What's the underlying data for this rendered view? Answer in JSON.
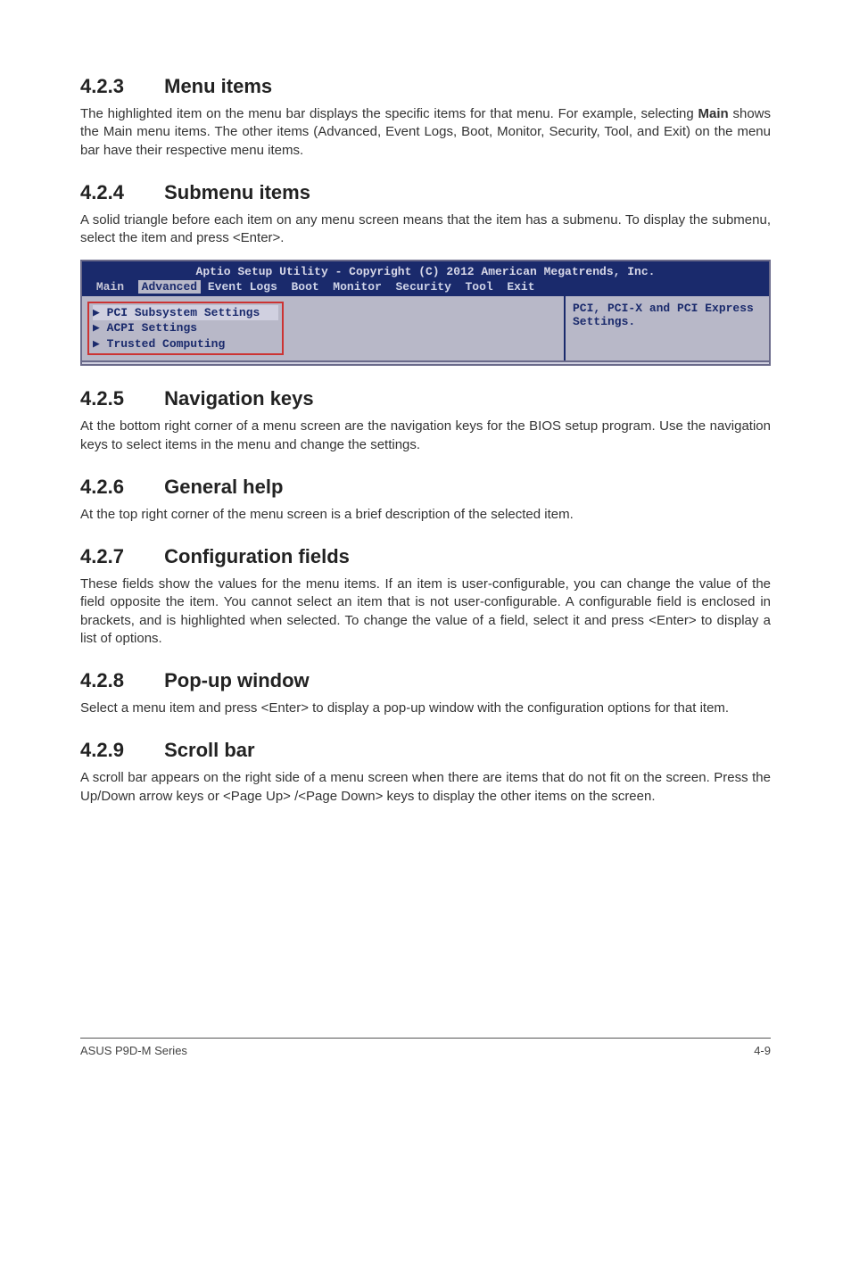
{
  "sections": {
    "s423": {
      "num": "4.2.3",
      "title": "Menu items",
      "body": "The highlighted item on the menu bar displays the specific items for that menu. For example, selecting ",
      "bold": "Main",
      "body2": " shows the Main menu items. The other items (Advanced, Event Logs, Boot, Monitor, Security, Tool, and Exit) on the menu bar have their respective menu items."
    },
    "s424": {
      "num": "4.2.4",
      "title": "Submenu items",
      "body": "A solid triangle before each item on any menu screen means that the item has a submenu. To display the submenu, select the item and press <Enter>."
    },
    "s425": {
      "num": "4.2.5",
      "title": "Navigation keys",
      "body": "At the bottom right corner of a menu screen are the navigation keys for the BIOS setup program. Use the navigation keys to select items in the menu and change the settings."
    },
    "s426": {
      "num": "4.2.6",
      "title": "General help",
      "body": "At the top right corner of the menu screen is a brief description of the selected item."
    },
    "s427": {
      "num": "4.2.7",
      "title": "Configuration fields",
      "body": "These fields show the values for the menu items. If an item is user-configurable, you can change the value of the field opposite the item. You cannot select an item that is not user-configurable. A configurable field is enclosed in brackets, and is highlighted when selected. To change the value of a field, select it and press <Enter> to display a list of options."
    },
    "s428": {
      "num": "4.2.8",
      "title": "Pop-up window",
      "body": "Select a menu item and press <Enter> to display a pop-up window with the configuration options for that item."
    },
    "s429": {
      "num": "4.2.9",
      "title": "Scroll bar",
      "body": "A scroll bar appears on the right side of a menu screen when there are items that do not fit on the screen. Press the Up/Down arrow keys or <Page Up> /<Page Down> keys to display the other items on the screen."
    }
  },
  "bios": {
    "title_line": "Aptio Setup Utility - Copyright (C) 2012 American Megatrends, Inc.",
    "tabs": {
      "main": "Main",
      "advanced": "Advanced",
      "rest": " Event Logs  Boot  Monitor  Security  Tool  Exit"
    },
    "items": {
      "pci": "PCI Subsystem Settings",
      "acpi": "ACPI Settings",
      "trusted": "Trusted Computing"
    },
    "help": "PCI, PCI-X and PCI Express Settings."
  },
  "footer": {
    "left": "ASUS P9D-M Series",
    "right": "4-9"
  }
}
